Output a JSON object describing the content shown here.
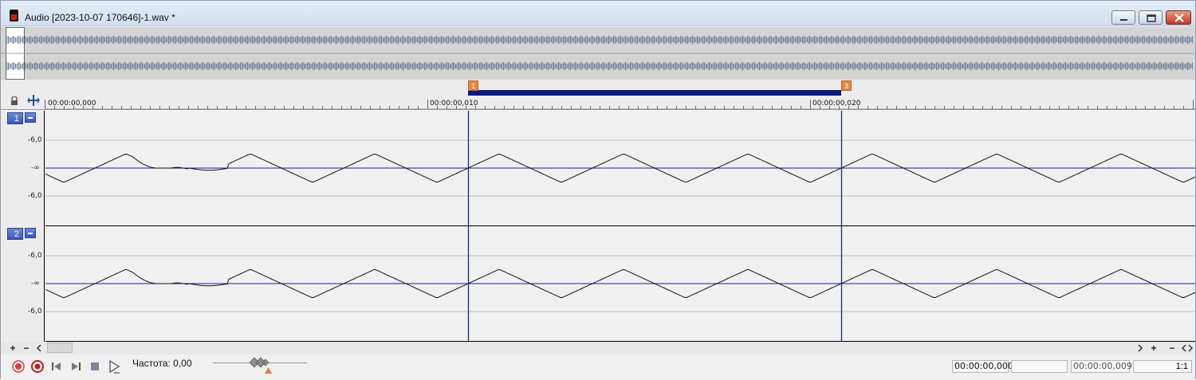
{
  "window": {
    "title": "Audio [2023-10-07 170646]-1.wav *",
    "icons": [
      "app-audio-icon",
      "minimize-icon",
      "maximize-icon",
      "close-icon"
    ]
  },
  "ruler": {
    "times": [
      "00:00:00,000",
      "00:00:00,010",
      "00:00:00,020"
    ],
    "markers": [
      "1",
      "3"
    ]
  },
  "tracks": [
    {
      "number": "1",
      "db_labels": [
        "-6,0",
        "-∞",
        "-6,0"
      ]
    },
    {
      "number": "2",
      "db_labels": [
        "-6,0",
        "-∞",
        "-6,0"
      ]
    }
  ],
  "transport": {
    "rate_label": "Частота: 0,00",
    "cursor_time": "00:00:00,000",
    "selection_start": "",
    "selection_length": "00:00:00,009",
    "zoom_ratio": "1:1"
  },
  "scroll": {
    "left_buttons": [
      "+",
      "−"
    ],
    "right_buttons": [
      "+",
      "−"
    ]
  },
  "colors": {
    "accent": "#0a1a7a",
    "marker": "#e08a45",
    "waveform": "#111111",
    "center_line": "#1a1aa8"
  }
}
